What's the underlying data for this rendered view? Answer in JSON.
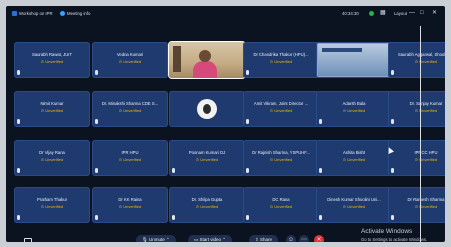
{
  "topbar": {
    "meeting_title": "Workshop on IPR",
    "meeting_info": "Meeting info",
    "timer": "40:34:30",
    "layout_label": "Layout"
  },
  "participants": [
    {
      "name": "Saurabh Rawat, JUIT",
      "status": "Unverified"
    },
    {
      "name": "Vedna Kumari",
      "status": "Unverified"
    },
    {
      "name": "",
      "status": "",
      "type": "video"
    },
    {
      "name": "Dr Chandrika Thakur (HPU)...",
      "status": "Unverified"
    },
    {
      "name": "",
      "status": "",
      "type": "screen"
    },
    {
      "name": "Saurabh Aggarwal, Shoolini ...",
      "status": "Unverified"
    },
    {
      "name": "Nimit Kumar",
      "status": "Unverified"
    },
    {
      "name": "Dr. Minakshi Sharma CDE S...",
      "status": "Unverified"
    },
    {
      "name": "",
      "status": "",
      "type": "avatar"
    },
    {
      "name": "Amit Vikram, Joint Director ...",
      "status": "Unverified"
    },
    {
      "name": "Adarsh Bala",
      "status": "Unverified"
    },
    {
      "name": "Dr. Sanjay Kumar",
      "status": "Unverified"
    },
    {
      "name": "Dr Vijay Rana",
      "status": "Unverified"
    },
    {
      "name": "IPR HPU",
      "status": "Unverified"
    },
    {
      "name": "Poonam Kumari DJ",
      "status": "Unverified"
    },
    {
      "name": "Dr Rajnish Sharma, YSPUHF...",
      "status": "Unverified"
    },
    {
      "name": "Ashita Bisht",
      "status": "Unverified"
    },
    {
      "name": "IPRCC HPU",
      "status": "Unverified"
    },
    {
      "name": "Pratham Thakur",
      "status": "Unverified"
    },
    {
      "name": "Dr KK Raina",
      "status": "Unverified"
    },
    {
      "name": "Dr. Shilpa Gupta",
      "status": "Unverified"
    },
    {
      "name": "DC Rana",
      "status": "Unverified"
    },
    {
      "name": "Dinesh Kumar Shoolini Uni...",
      "status": "Unverified"
    },
    {
      "name": "Dr Ramesh Sharma",
      "status": "Unverified"
    }
  ],
  "toolbar": {
    "unmute_label": "Unmute",
    "video_label": "Start video",
    "share_label": "Share"
  },
  "watermark": {
    "title": "Activate Windows",
    "subtitle": "Go to Settings to activate Windows."
  },
  "colors": {
    "tile_bg": "#1f3a6e",
    "status_text": "#f2b705",
    "leave_button": "#e0303a"
  }
}
